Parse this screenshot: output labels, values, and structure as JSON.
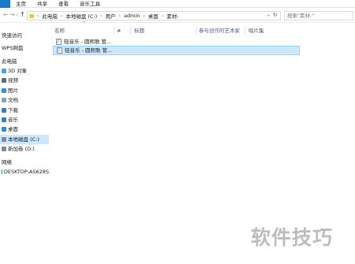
{
  "ribbon": {
    "file_label": "",
    "tabs": [
      "主页",
      "共享",
      "查看",
      "音乐工具"
    ]
  },
  "nav": {
    "back": "←",
    "forward": "→",
    "dropdown": "⌄",
    "up": "↑",
    "address_dropdown": "⌄",
    "refresh": "↻"
  },
  "address": {
    "crumbs": [
      "此电脑",
      "本地磁盘 (C:)",
      "用户",
      "admin",
      "桌面",
      "素材-"
    ]
  },
  "search": {
    "placeholder": "搜索\"素材-\""
  },
  "sidebar": {
    "items": [
      {
        "label": "快速访问",
        "icon": "star-icon",
        "selected": false
      },
      {
        "label": "WPS网盘",
        "icon": "cloud-icon",
        "selected": false
      },
      {
        "label": "此电脑",
        "icon": "computer-icon",
        "selected": false
      },
      {
        "label": "3D 对象",
        "icon": "cube-icon",
        "selected": false
      },
      {
        "label": "视频",
        "icon": "video-icon",
        "selected": false
      },
      {
        "label": "图片",
        "icon": "picture-icon",
        "selected": false
      },
      {
        "label": "文档",
        "icon": "document-icon",
        "selected": false
      },
      {
        "label": "下载",
        "icon": "download-icon",
        "selected": false
      },
      {
        "label": "音乐",
        "icon": "music-icon",
        "selected": false
      },
      {
        "label": "桌面",
        "icon": "desktop-icon",
        "selected": false
      },
      {
        "label": "本地磁盘 (C:)",
        "icon": "drive-icon",
        "selected": true
      },
      {
        "label": "新加卷 (D:)",
        "icon": "drive-icon",
        "selected": false
      },
      {
        "label": "网络",
        "icon": "network-icon",
        "selected": false
      },
      {
        "label": "DESKTOP-AS628S",
        "icon": "computer-icon",
        "selected": false
      }
    ]
  },
  "columns": {
    "name": "名称",
    "number": "#",
    "title": "标题",
    "artist": "参与创作的艺术家",
    "album": "唱片集",
    "sort_indicator": "^"
  },
  "files": [
    {
      "name": "轻音乐 - 圆熙歌 管...",
      "selected": false
    },
    {
      "name": "轻音乐 - 圆熙歌 管...",
      "selected": true
    }
  ],
  "watermark": {
    "text": "软件技巧"
  },
  "colors": {
    "accent": "#1979ca",
    "selection": "#cce8ff",
    "selection_border": "#99d1ff"
  }
}
